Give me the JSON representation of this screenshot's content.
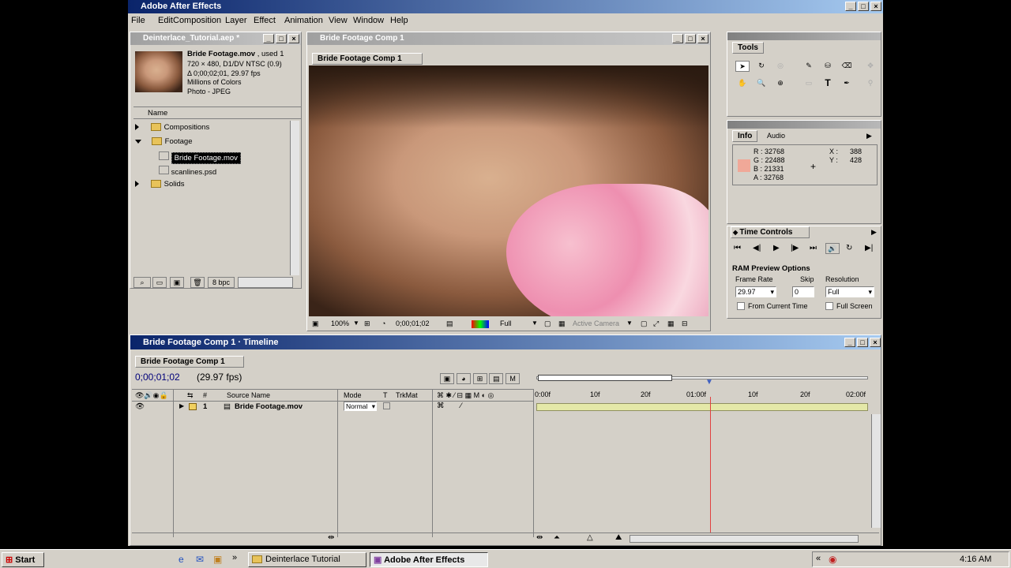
{
  "app": {
    "title": "Adobe After Effects"
  },
  "menu": [
    "File",
    "Edit",
    "Composition",
    "Layer",
    "Effect",
    "Animation",
    "View",
    "Window",
    "Help"
  ],
  "project": {
    "title": "Deinterlace_Tutorial.aep *",
    "footage_name": "Bride Footage.mov",
    "used": ", used 1",
    "info": [
      "720 × 480, D1/DV NTSC (0.9)",
      "Δ 0;00;02;01, 29.97 fps",
      "Millions of Colors",
      "Photo - JPEG"
    ],
    "column": "Name",
    "items": [
      {
        "label": "Compositions",
        "expanded": false
      },
      {
        "label": "Footage",
        "expanded": true
      },
      {
        "label": "Bride Footage.mov",
        "child": true,
        "selected": true
      },
      {
        "label": "scanlines.psd",
        "child": true
      },
      {
        "label": "Solids",
        "expanded": false
      }
    ],
    "bpc": "8 bpc"
  },
  "comp": {
    "window_title": "Bride Footage Comp 1",
    "tab": "Bride Footage Comp 1",
    "zoom": "100%",
    "timecode": "0;00;01;02",
    "resolution": "Full",
    "camera": "Active Camera"
  },
  "tools": {
    "title": "Tools"
  },
  "info": {
    "tabs": [
      "Info",
      "Audio"
    ],
    "r": "R : 32768",
    "g": "G : 22488",
    "b": "B : 21331",
    "a": "A : 32768",
    "x_label": "X :",
    "x": "388",
    "y_label": "Y :",
    "y": "428",
    "swatch": "#f0a898"
  },
  "time_controls": {
    "title": "Time Controls",
    "ram_title": "RAM Preview Options",
    "frame_rate_label": "Frame Rate",
    "frame_rate": "29.97",
    "skip_label": "Skip",
    "skip": "0",
    "resolution_label": "Resolution",
    "resolution": "Full",
    "from_current": "From Current Time",
    "full_screen": "Full Screen"
  },
  "timeline": {
    "window_title": "Bride Footage Comp 1 · Timeline",
    "tab": "Bride Footage Comp 1",
    "timecode": "0;00;01;02",
    "fps": "(29.97 fps)",
    "col_hash": "#",
    "col_source": "Source Name",
    "col_mode": "Mode",
    "col_t": "T",
    "col_trkmat": "TrkMat",
    "ruler": [
      "0:00f",
      "10f",
      "20f",
      "01:00f",
      "10f",
      "20f",
      "02:00f"
    ],
    "layer": {
      "num": "1",
      "name": "Bride Footage.mov",
      "mode": "Normal"
    }
  },
  "taskbar": {
    "start": "Start",
    "tasks": [
      "Deinterlace Tutorial",
      "Adobe After Effects"
    ],
    "clock": "4:16 AM"
  }
}
